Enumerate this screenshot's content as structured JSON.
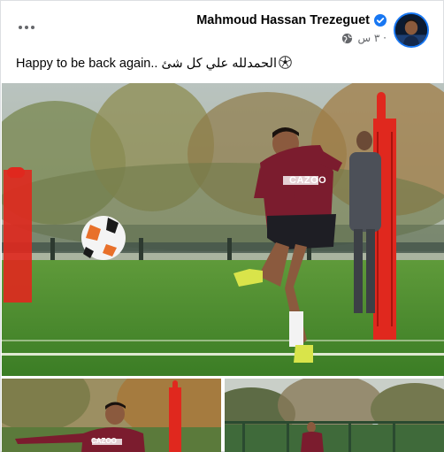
{
  "post": {
    "author": "Mahmoud Hassan Trezeguet",
    "time": "٣ س ·",
    "caption": "Happy to be back again.. الحمدلله علي كل شئ",
    "icons": {
      "more": "more-options-icon",
      "verified": "verified-badge-icon",
      "audience": "globe-icon",
      "emoji": "soccer-ball-emoji"
    }
  },
  "photos": {
    "shirt_sponsor": "CAZOO"
  },
  "colors": {
    "facebook_blue": "#1877f2",
    "secondary_text": "#65676b",
    "kit_claret": "#7b1c2e",
    "pitch_green": "#3f8a2a",
    "training_pole_red": "#e0281e"
  }
}
